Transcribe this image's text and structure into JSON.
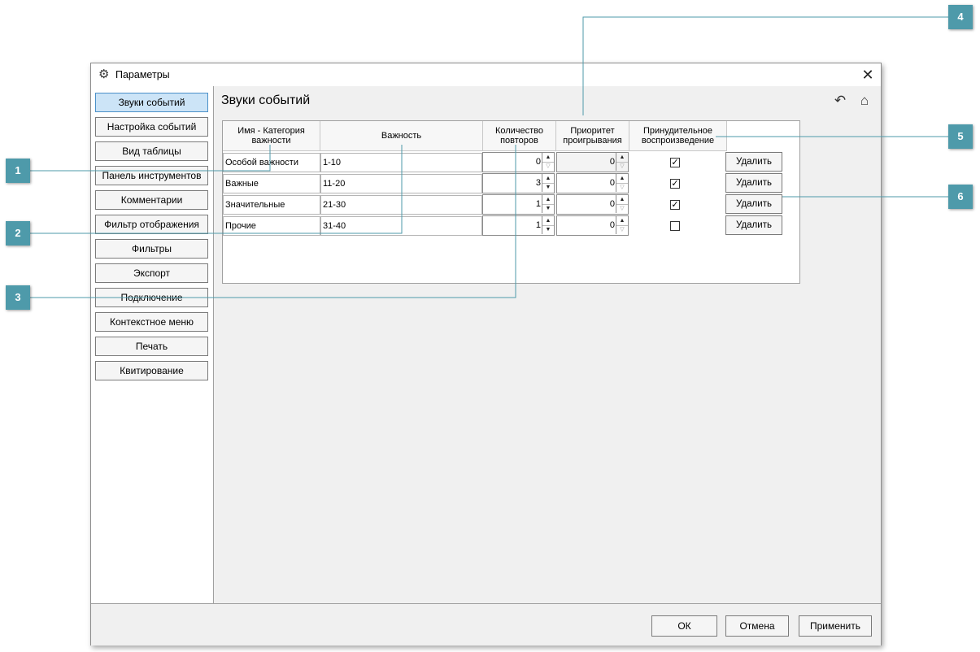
{
  "window": {
    "title": "Параметры",
    "icon": "gear-icon"
  },
  "sidebar": {
    "items": [
      {
        "label": "Звуки событий",
        "active": true
      },
      {
        "label": "Настройка событий"
      },
      {
        "label": "Вид таблицы"
      },
      {
        "label": "Панель инструментов"
      },
      {
        "label": "Комментарии"
      },
      {
        "label": "Фильтр отображения"
      },
      {
        "label": "Фильтры"
      },
      {
        "label": "Экспорт"
      },
      {
        "label": "Подключение"
      },
      {
        "label": "Контекстное меню"
      },
      {
        "label": "Печать"
      },
      {
        "label": "Квитирование"
      }
    ]
  },
  "main": {
    "title": "Звуки событий",
    "icons": {
      "back": "undo-arrow-icon",
      "home": "home-icon"
    },
    "table": {
      "headers": {
        "name": "Имя - Категория важности",
        "importance": "Важность",
        "repeats": "Количество повторов",
        "priority": "Приоритет проигрывания",
        "forced": "Принудительное воспроизведение"
      },
      "rows": [
        {
          "name": "Особой важности",
          "range": "1-10",
          "repeats": "0",
          "priority": "0",
          "forced": true,
          "delete": "Удалить"
        },
        {
          "name": "Важные",
          "range": "11-20",
          "repeats": "3",
          "priority": "0",
          "forced": true,
          "delete": "Удалить"
        },
        {
          "name": "Значительные",
          "range": "21-30",
          "repeats": "1",
          "priority": "0",
          "forced": true,
          "delete": "Удалить"
        },
        {
          "name": "Прочие",
          "range": "31-40",
          "repeats": "1",
          "priority": "0",
          "forced": false,
          "delete": "Удалить"
        }
      ]
    }
  },
  "footer": {
    "ok": "ОК",
    "cancel": "Отмена",
    "apply": "Применить"
  },
  "callouts": [
    "1",
    "2",
    "3",
    "4",
    "5",
    "6"
  ],
  "colors": {
    "callout": "#4e9aaa",
    "active_nav": "#cce4f7"
  }
}
